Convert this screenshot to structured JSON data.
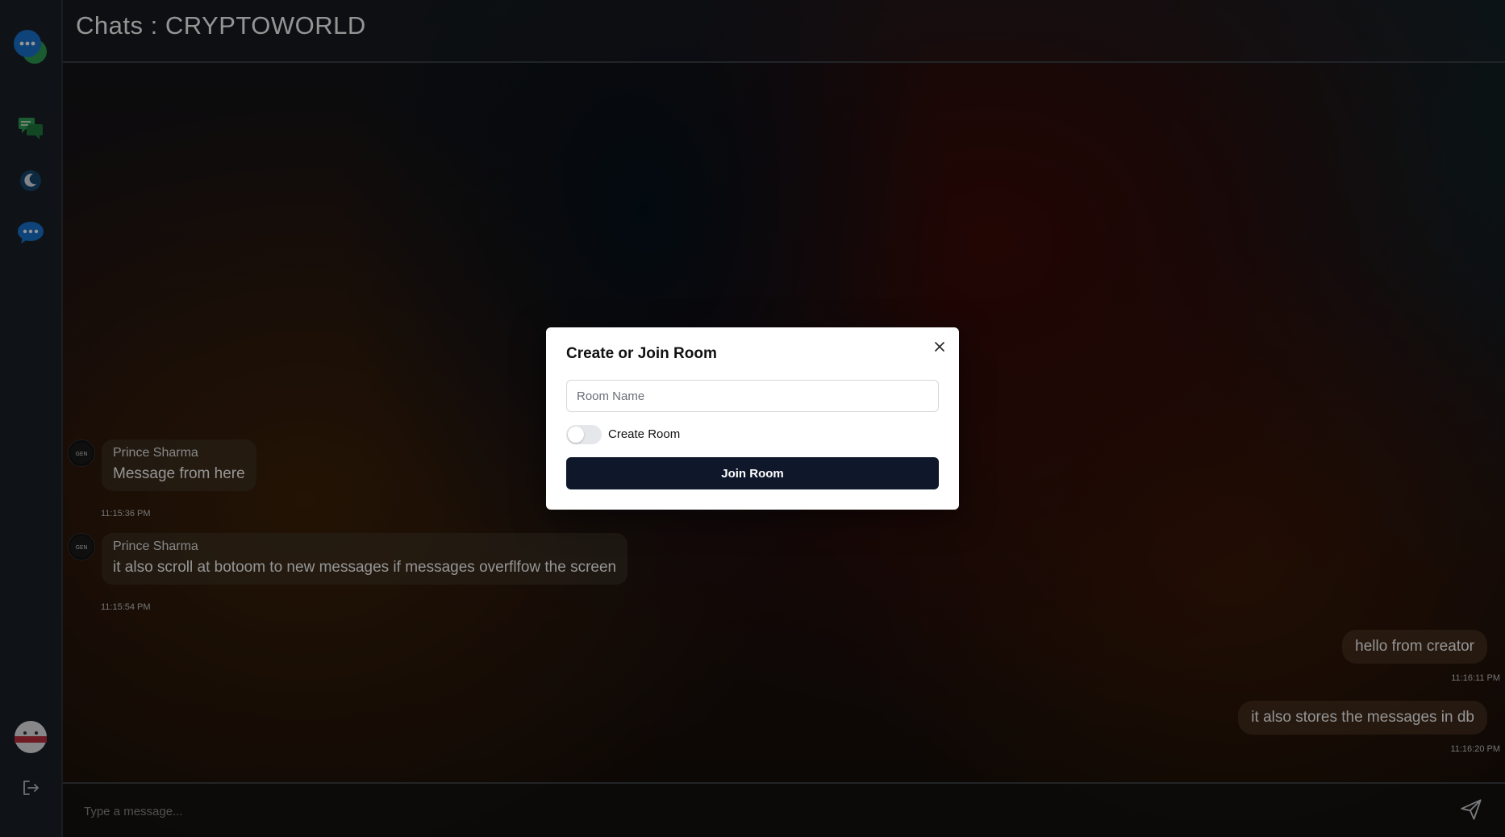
{
  "header": {
    "title": "Chats : CRYPTOWORLD"
  },
  "sidebar": {
    "items": [
      {
        "icon": "chat-bubbles-logo-icon"
      },
      {
        "icon": "chats-icon"
      },
      {
        "icon": "theme-toggle-icon"
      },
      {
        "icon": "messages-icon"
      }
    ],
    "bottom": [
      {
        "icon": "user-avatar"
      },
      {
        "icon": "logout-icon"
      }
    ]
  },
  "messages": [
    {
      "direction": "incoming",
      "sender": "Prince Sharma",
      "text": "Message from here",
      "time": "11:15:36 PM"
    },
    {
      "direction": "incoming",
      "sender": "Prince Sharma",
      "text": "it also scroll at botoom to new messages if messages overflfow the screen",
      "time": "11:15:54 PM"
    },
    {
      "direction": "outgoing",
      "text": "hello from creator",
      "time": "11:16:11 PM"
    },
    {
      "direction": "outgoing",
      "text": "it also stores the messages in db",
      "time": "11:16:20 PM"
    }
  ],
  "composer": {
    "placeholder": "Type a message..."
  },
  "modal": {
    "title": "Create or Join Room",
    "input_placeholder": "Room Name",
    "input_value": "",
    "toggle_label": "Create Room",
    "toggle_on": false,
    "submit_label": "Join Room"
  },
  "colors": {
    "modal_button": "#0f172a",
    "sidebar_bg": "#1b2128",
    "accent_blue": "#1e88e5",
    "accent_green": "#22a34a"
  }
}
